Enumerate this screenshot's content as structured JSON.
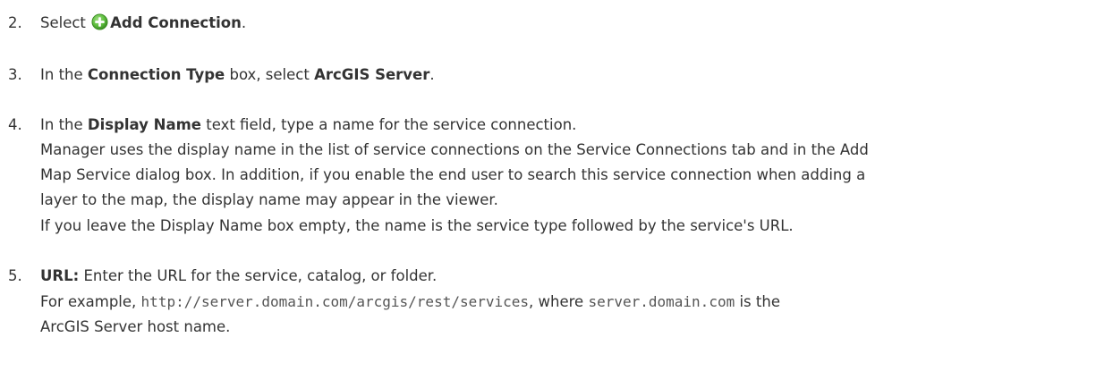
{
  "steps": [
    {
      "number": "2.",
      "prefix": "Select",
      "icon": "add-circle-icon",
      "bold": "Add Connection",
      "suffix": "."
    },
    {
      "number": "3.",
      "text1": "In the ",
      "bold1": "Connection Type",
      "text2": " box, select ",
      "bold2": "ArcGIS Server",
      "text3": "."
    },
    {
      "number": "4.",
      "text1": "In the ",
      "bold1": "Display Name",
      "text2": " text field, type a name for the service connection.",
      "para1_line1": "Manager uses the display name in the list of service connections on the Service Connections tab and in the Add",
      "para1_line2": "Map Service dialog box. In addition, if you enable the end user to search this service connection when adding a",
      "para1_line3": "layer to the map, the display name may appear in the viewer.",
      "para2": "If you leave the Display Name box empty, the name is the service type followed by the service's URL."
    },
    {
      "number": "5.",
      "bold1": "URL:",
      "text1": " Enter the URL for the service, catalog, or folder.",
      "ex_prefix": "For example, ",
      "ex_code1": "http://server.domain.com/arcgis/rest/services",
      "ex_mid": ", where ",
      "ex_code2": "server.domain.com",
      "ex_suffix": " is the",
      "ex_line2": "ArcGIS Server host name."
    }
  ],
  "colors": {
    "text": "#333333",
    "icon_green": "#4caf3c"
  }
}
